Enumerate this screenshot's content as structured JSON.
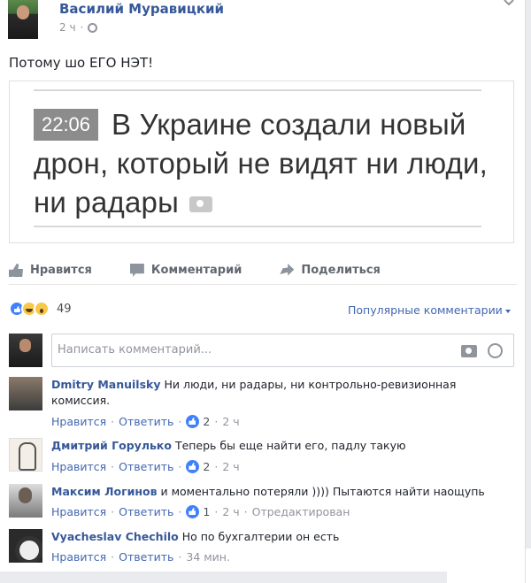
{
  "post": {
    "author": "Василий Муравицкий",
    "time": "2 ч",
    "text": "Потому шо ЕГО НЭТ!",
    "image": {
      "time": "22:06",
      "headline": "В Украине создали новый дрон, который не видят ни люди, ни радары"
    }
  },
  "actions": {
    "like": "Нравится",
    "comment": "Комментарий",
    "share": "Поделиться"
  },
  "reactions": {
    "count": "49",
    "sort_label": "Популярные комментарии"
  },
  "comment_box": {
    "placeholder": "Написать комментарий..."
  },
  "comments": [
    {
      "name": "Dmitry Manuilsky",
      "text": "Ни люди, ни радары, ни контрольно-ревизионная комиссия.",
      "like": "Нравится",
      "reply": "Ответить",
      "likes": "2",
      "time": "2 ч",
      "edited": ""
    },
    {
      "name": "Дмитрий Горулько",
      "text": "Теперь бы еще найти его, падлу такую",
      "like": "Нравится",
      "reply": "Ответить",
      "likes": "2",
      "time": "2 ч",
      "edited": ""
    },
    {
      "name": "Максим Логинов",
      "text": "и моментально потеряли )))) Пытаются найти наощупь",
      "like": "Нравится",
      "reply": "Ответить",
      "likes": "1",
      "time": "2 ч",
      "edited": "Отредактирован"
    },
    {
      "name": "Vyacheslav Chechilo",
      "text": "Но по бухгалтерии он есть",
      "like": "Нравится",
      "reply": "Ответить",
      "likes": "",
      "time": "34 мин.",
      "edited": ""
    }
  ],
  "colors": {
    "link": "#365899",
    "accent": "#4267b2",
    "muted": "#90949c",
    "like_blue": "#4080ff"
  }
}
